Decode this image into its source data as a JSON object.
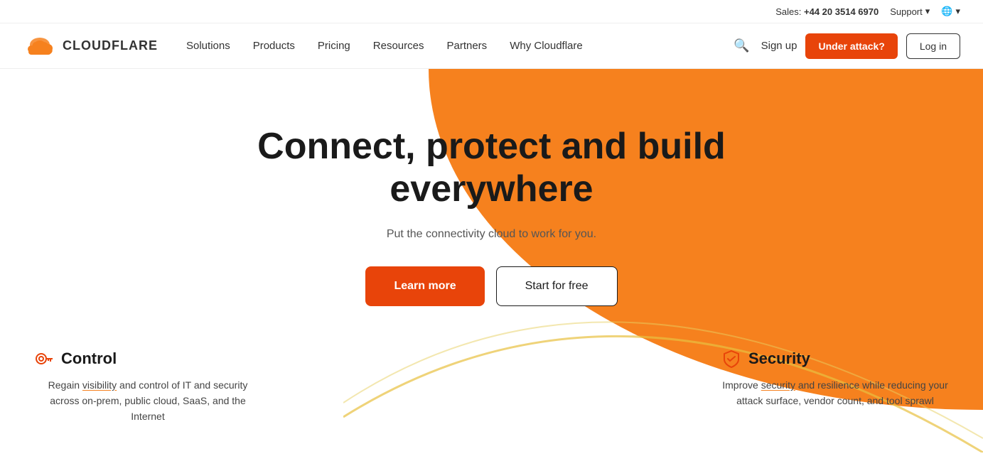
{
  "topbar": {
    "sales_label": "Sales:",
    "sales_phone": "+44 20 3514 6970",
    "support_label": "Support",
    "globe_label": ""
  },
  "navbar": {
    "logo_text": "CLOUDFLARE",
    "nav_items": [
      {
        "label": "Solutions",
        "id": "solutions"
      },
      {
        "label": "Products",
        "id": "products"
      },
      {
        "label": "Pricing",
        "id": "pricing"
      },
      {
        "label": "Resources",
        "id": "resources"
      },
      {
        "label": "Partners",
        "id": "partners"
      },
      {
        "label": "Why Cloudflare",
        "id": "why-cloudflare"
      }
    ],
    "signup_label": "Sign up",
    "under_attack_label": "Under attack?",
    "login_label": "Log in"
  },
  "hero": {
    "title": "Connect, protect and build everywhere",
    "subtitle": "Put the connectivity cloud to work for you.",
    "learn_more_label": "Learn more",
    "start_free_label": "Start for free"
  },
  "features": [
    {
      "id": "control",
      "icon": "control-icon",
      "title": "Control",
      "description": "Regain visibility and control of IT and security across on-prem, public cloud, SaaS, and the Internet",
      "highlight": "visibility"
    },
    {
      "id": "security",
      "icon": "security-icon",
      "title": "Security",
      "description": "Improve security and resilience while reducing your attack surface, vendor count, and tool sprawl",
      "highlight": "security"
    }
  ],
  "colors": {
    "orange": "#f6811e",
    "dark_orange": "#e8440a",
    "text_dark": "#1a1a1a",
    "text_mid": "#555"
  }
}
